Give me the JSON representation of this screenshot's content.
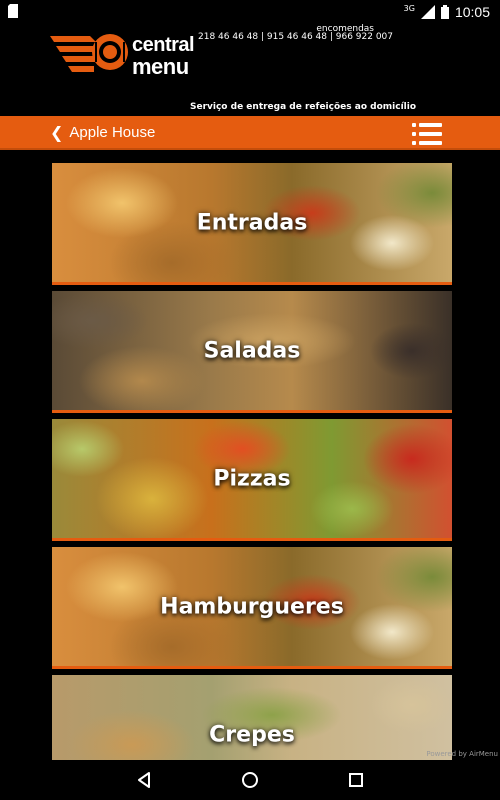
{
  "status_bar": {
    "network": "3G",
    "time": "10:05"
  },
  "header": {
    "logo": {
      "line1": "central",
      "line2": "menu"
    },
    "orders_label": "encomendas",
    "phones": "218 46 46 48 | 915 46 46 48 | 966 922 007",
    "tagline": "Serviço de entrega de refeições ao domicílio"
  },
  "navbar": {
    "back_label": "Apple House",
    "back_icon": "chevron-left-icon",
    "menu_icon": "list-menu-icon"
  },
  "categories": [
    {
      "label": "Entradas"
    },
    {
      "label": "Saladas"
    },
    {
      "label": "Pizzas"
    },
    {
      "label": "Hamburgueres"
    },
    {
      "label": "Crepes"
    }
  ],
  "footer": {
    "powered_by": "Powered by AirMenu"
  },
  "colors": {
    "accent": "#e55c10",
    "background": "#000000"
  }
}
